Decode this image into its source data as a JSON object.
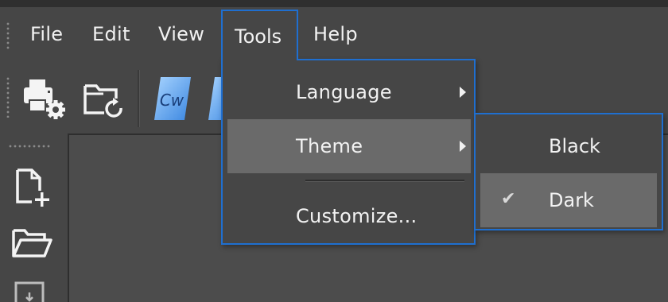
{
  "menubar": {
    "items": [
      {
        "label": "File"
      },
      {
        "label": "Edit"
      },
      {
        "label": "View"
      },
      {
        "label": "Tools"
      },
      {
        "label": "Help"
      }
    ]
  },
  "toolbar": {
    "buttons": [
      {
        "icon": "print-settings-icon"
      },
      {
        "icon": "folder-refresh-icon"
      },
      {
        "icon": "cw-icon",
        "label": "Cw"
      },
      {
        "icon": "cw-icon-partial"
      }
    ]
  },
  "sidebar": {
    "buttons": [
      {
        "icon": "new-file-icon"
      },
      {
        "icon": "open-folder-icon"
      },
      {
        "icon": "import-icon"
      }
    ]
  },
  "tools_menu": {
    "items": [
      {
        "label": "Language",
        "has_submenu": true
      },
      {
        "label": "Theme",
        "has_submenu": true,
        "highlighted": true
      },
      {
        "label": "Customize...",
        "has_submenu": false
      }
    ]
  },
  "theme_submenu": {
    "items": [
      {
        "label": "Black",
        "checked": false
      },
      {
        "label": "Dark",
        "checked": true,
        "highlighted": true
      }
    ],
    "check_glyph": "✔"
  },
  "colors": {
    "accent": "#1f6fd0",
    "background": "#464646",
    "highlight": "#6a6a6a",
    "text": "#f2f2f2"
  }
}
